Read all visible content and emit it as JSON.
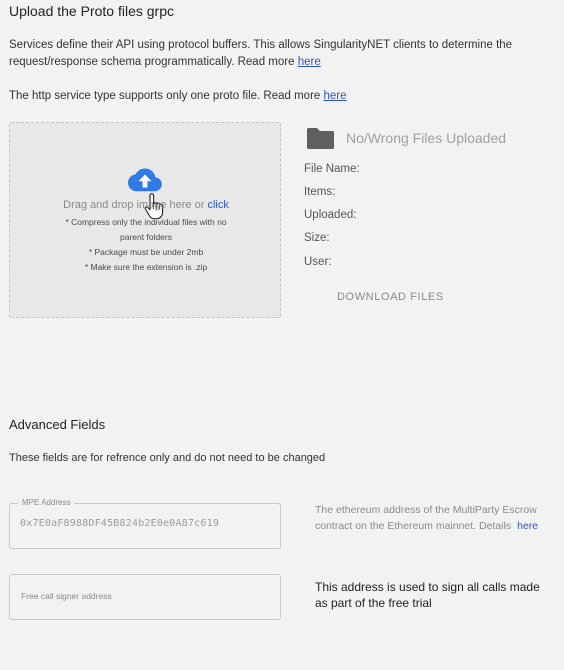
{
  "upload": {
    "title": "Upload the Proto files grpc",
    "intro_text": "Services define their API using protocol buffers. This allows SingularityNET clients to determine the request/response schema programmatically. Read more",
    "intro_link": "here",
    "http_text": "The http service type supports only one proto file. Read more",
    "http_link": "here",
    "dropzone": {
      "drag_text": "Drag and drop image here or",
      "click_label": "click",
      "hints": [
        "* Compress only the individual files with no",
        "parent folders",
        "* Package must be under 2mb",
        "* Make sure the extension is .zip"
      ]
    },
    "status": "No/Wrong Files Uploaded",
    "meta": {
      "file_name_label": "File Name:",
      "items_label": "Items:",
      "uploaded_label": "Uploaded:",
      "size_label": "Size:",
      "user_label": "User:"
    },
    "download_label": "DOWNLOAD FILES"
  },
  "advanced": {
    "title": "Advanced Fields",
    "subtitle": "These fields are for refrence only and do not need to be changed",
    "mpe": {
      "label": "MPE Address",
      "value": "0x7E0aF8988DF45B824b2E0e0A87c619",
      "description": "The ethereum address of the MultiParty Escrow contract on the Ethereum mainnet. Details",
      "link": "here"
    },
    "signer": {
      "placeholder": "Free call signer address",
      "description": "This address is used to sign all calls made as part of the free trial"
    }
  },
  "colors": {
    "link": "#2f56c9",
    "cloud_icon": "#2f7ae5",
    "folder_icon": "#5f5f5f"
  }
}
